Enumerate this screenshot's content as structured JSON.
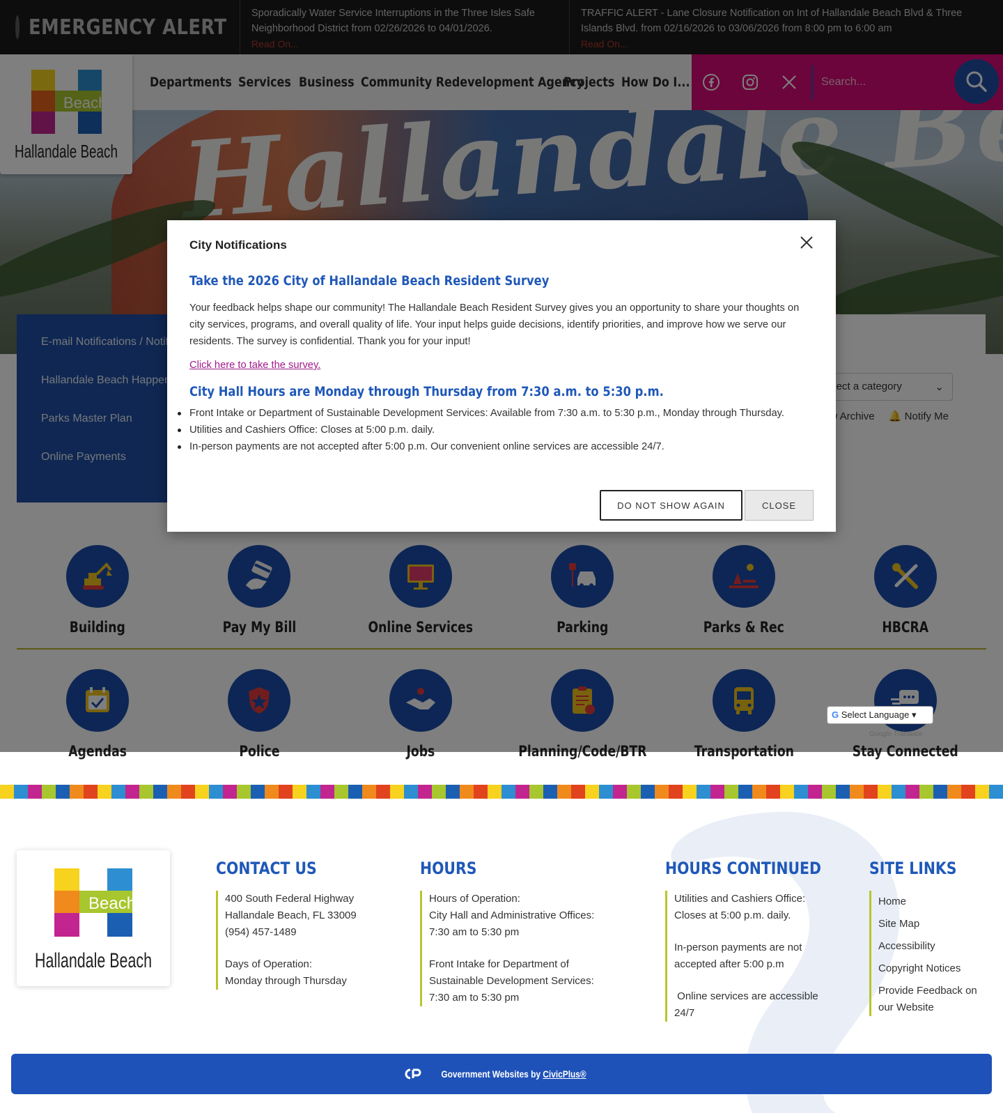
{
  "alert_bar": {
    "label": "EMERGENCY ALERT",
    "items": [
      {
        "text": "Sporadically Water Service Interruptions in the Three Isles Safe Neighborhood District from 02/26/2026 to 04/01/2026.",
        "more": "Read On..."
      },
      {
        "text": "TRAFFIC ALERT - Lane Closure Notification on Int of Hallandale Beach Blvd & Three Islands Blvd. from 02/16/2026 to 03/06/2026 from 8:00 pm to 6:00 am",
        "more": "Read On..."
      }
    ]
  },
  "header": {
    "logo_word_beach": "Beach",
    "logo_text": "Hallandale Beach",
    "hero_script": "Hallandale Beach",
    "nav": [
      "Departments",
      "Services",
      "Business",
      "Community Redevelopment Agency",
      "Projects",
      "How Do I..."
    ],
    "social": [
      "facebook-icon",
      "instagram-icon",
      "x-icon"
    ],
    "search_placeholder": "Search..."
  },
  "quick_links": [
    "E-mail Notifications / Notify Me",
    "Hallandale Beach Happenings",
    "Parks Master Plan",
    "Online Payments"
  ],
  "news": {
    "category_placeholder": "Select a category",
    "archive_label": "View Archive",
    "notify_label": "Notify Me"
  },
  "tiles": [
    {
      "label": "Building",
      "icon": "excavator-icon"
    },
    {
      "label": "Pay My Bill",
      "icon": "credit-card-icon"
    },
    {
      "label": "Online Services",
      "icon": "monitor-icon"
    },
    {
      "label": "Parking",
      "icon": "car-parking-icon"
    },
    {
      "label": "Parks & Rec",
      "icon": "park-icon"
    },
    {
      "label": "HBCRA",
      "icon": "tools-icon"
    },
    {
      "label": "Agendas",
      "icon": "calendar-check-icon"
    },
    {
      "label": "Police",
      "icon": "police-badge-icon"
    },
    {
      "label": "Jobs",
      "icon": "handshake-icon"
    },
    {
      "label": "Planning/Code/BTR",
      "icon": "clipboard-icon"
    },
    {
      "label": "Transportation",
      "icon": "bus-icon"
    },
    {
      "label": "Stay Connected",
      "icon": "chat-icon"
    }
  ],
  "translate": {
    "select_label": "Select Language",
    "credit": "Google Translate"
  },
  "modal": {
    "title": "City Notifications",
    "heading1": "Take the 2026 City of Hallandale Beach Resident Survey",
    "paragraph": "Your feedback helps shape our community! The Hallandale Beach Resident Survey gives you an opportunity to share your thoughts on city services, programs, and overall quality of life. Your input helps guide decisions, identify priorities, and improve how we serve our residents. The survey is confidential. Thank you for your input!",
    "survey_link": "Click here to take the survey.",
    "heading2": "City Hall Hours are Monday through Thursday from 7:30 a.m. to 5:30 p.m.",
    "bullets": [
      "Front Intake or Department of Sustainable Development Services: Available from 7:30 a.m. to 5:30 p.m., Monday through Thursday.",
      "Utilities and Cashiers Office: Closes at 5:00 p.m. daily.",
      "In-person payments are not accepted after 5:00 p.m. Our convenient online services are accessible 24/7."
    ],
    "btn_noshow": "DO NOT SHOW AGAIN",
    "btn_close": "CLOSE"
  },
  "footer": {
    "contact": {
      "heading": "CONTACT US",
      "lines": [
        "400 South Federal Highway",
        "Hallandale Beach, FL 33009",
        "(954) 457-1489"
      ],
      "lines2": [
        "Days of Operation:",
        "Monday through Thursday"
      ]
    },
    "hours": {
      "heading": "HOURS",
      "lines": [
        "Hours of Operation:",
        "City Hall and Administrative Offices:",
        "7:30 am to 5:30 pm"
      ],
      "lines2": [
        "Front Intake for Department of",
        "Sustainable Development Services:",
        "7:30 am to 5:30 pm"
      ]
    },
    "hours_cont": {
      "heading": "HOURS CONTINUED",
      "p1": [
        "Utilities and Cashiers Office:",
        "Closes at 5:00 p.m. daily."
      ],
      "p2": [
        "In-person payments are not",
        "accepted after 5:00 p.m"
      ],
      "p3": [
        " Online services are accessible",
        "24/7"
      ]
    },
    "site_links": {
      "heading": "SITE LINKS",
      "links": [
        "Home",
        "Site Map",
        "Accessibility",
        "Copyright Notices",
        "Provide Feedback on",
        "our Website"
      ]
    },
    "credit_prefix": "Government Websites by ",
    "credit_brand": "CivicPlus®"
  },
  "colors": {
    "brand_blue": "#1f4fa5",
    "brand_pink": "#d80a77",
    "accent_lime": "#b9c52c",
    "alert_red": "#b23a2a"
  }
}
